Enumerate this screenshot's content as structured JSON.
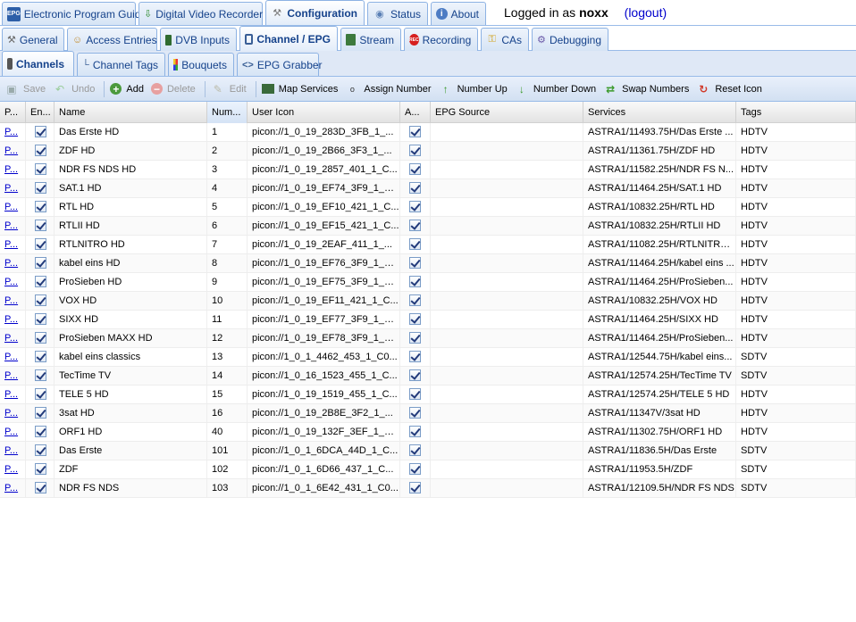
{
  "top_tabs": [
    {
      "label": "Electronic Program Guide",
      "icon": "epg-icon"
    },
    {
      "label": "Digital Video Recorder",
      "icon": "dvr-download-icon"
    },
    {
      "label": "Configuration",
      "icon": "wrench-icon"
    },
    {
      "label": "Status",
      "icon": "eye-icon"
    },
    {
      "label": "About",
      "icon": "info-icon"
    }
  ],
  "login": {
    "prefix": "Logged in as",
    "user": "noxx",
    "logout": "(logout)"
  },
  "config_tabs": [
    {
      "label": "General",
      "icon": "tools-icon"
    },
    {
      "label": "Access Entries",
      "icon": "users-icon"
    },
    {
      "label": "DVB Inputs",
      "icon": "card-icon"
    },
    {
      "label": "Channel / EPG",
      "icon": "tv-icon"
    },
    {
      "label": "Stream",
      "icon": "stream-icon"
    },
    {
      "label": "Recording",
      "icon": "rec-icon"
    },
    {
      "label": "CAs",
      "icon": "key-icon"
    },
    {
      "label": "Debugging",
      "icon": "bug-icon"
    }
  ],
  "channel_tabs": [
    {
      "label": "Channels",
      "icon": "remote-icon"
    },
    {
      "label": "Channel Tags",
      "icon": "tree-icon"
    },
    {
      "label": "Bouquets",
      "icon": "grid-icon"
    },
    {
      "label": "EPG Grabber",
      "icon": "code-icon"
    }
  ],
  "toolbar": {
    "save": "Save",
    "undo": "Undo",
    "add": "Add",
    "delete": "Delete",
    "edit": "Edit",
    "map_services": "Map Services",
    "assign_number": "Assign Number",
    "number_up": "Number Up",
    "number_down": "Number Down",
    "swap_numbers": "Swap Numbers",
    "reset_icon": "Reset Icon"
  },
  "columns": [
    "P...",
    "En...",
    "Name",
    "Num...",
    "User Icon",
    "A...",
    "EPG Source",
    "Services",
    "Tags"
  ],
  "rows": [
    {
      "p": "P...",
      "name": "Das Erste HD",
      "num": "1",
      "icon": "picon://1_0_19_283D_3FB_1_...",
      "epg": "",
      "services": "ASTRA1/11493.75H/Das Erste ...",
      "tags": "HDTV"
    },
    {
      "p": "P...",
      "name": "ZDF HD",
      "num": "2",
      "icon": "picon://1_0_19_2B66_3F3_1_...",
      "epg": "",
      "services": "ASTRA1/11361.75H/ZDF HD",
      "tags": "HDTV"
    },
    {
      "p": "P...",
      "name": "NDR FS NDS HD",
      "num": "3",
      "icon": "picon://1_0_19_2857_401_1_C...",
      "epg": "",
      "services": "ASTRA1/11582.25H/NDR FS N...",
      "tags": "HDTV"
    },
    {
      "p": "P...",
      "name": "SAT.1 HD",
      "num": "4",
      "icon": "picon://1_0_19_EF74_3F9_1_C...",
      "epg": "",
      "services": "ASTRA1/11464.25H/SAT.1 HD",
      "tags": "HDTV"
    },
    {
      "p": "P...",
      "name": "RTL HD",
      "num": "5",
      "icon": "picon://1_0_19_EF10_421_1_C...",
      "epg": "",
      "services": "ASTRA1/10832.25H/RTL HD",
      "tags": "HDTV"
    },
    {
      "p": "P...",
      "name": "RTLII HD",
      "num": "6",
      "icon": "picon://1_0_19_EF15_421_1_C...",
      "epg": "",
      "services": "ASTRA1/10832.25H/RTLII HD",
      "tags": "HDTV"
    },
    {
      "p": "P...",
      "name": "RTLNITRO HD",
      "num": "7",
      "icon": "picon://1_0_19_2EAF_411_1_...",
      "epg": "",
      "services": "ASTRA1/11082.25H/RTLNITRO...",
      "tags": "HDTV"
    },
    {
      "p": "P...",
      "name": "kabel eins HD",
      "num": "8",
      "icon": "picon://1_0_19_EF76_3F9_1_C...",
      "epg": "",
      "services": "ASTRA1/11464.25H/kabel eins ...",
      "tags": "HDTV"
    },
    {
      "p": "P...",
      "name": "ProSieben HD",
      "num": "9",
      "icon": "picon://1_0_19_EF75_3F9_1_C...",
      "epg": "",
      "services": "ASTRA1/11464.25H/ProSieben...",
      "tags": "HDTV"
    },
    {
      "p": "P...",
      "name": "VOX HD",
      "num": "10",
      "icon": "picon://1_0_19_EF11_421_1_C...",
      "epg": "",
      "services": "ASTRA1/10832.25H/VOX HD",
      "tags": "HDTV"
    },
    {
      "p": "P...",
      "name": "SIXX HD",
      "num": "11",
      "icon": "picon://1_0_19_EF77_3F9_1_C...",
      "epg": "",
      "services": "ASTRA1/11464.25H/SIXX HD",
      "tags": "HDTV"
    },
    {
      "p": "P...",
      "name": "ProSieben MAXX HD",
      "num": "12",
      "icon": "picon://1_0_19_EF78_3F9_1_C...",
      "epg": "",
      "services": "ASTRA1/11464.25H/ProSieben...",
      "tags": "HDTV"
    },
    {
      "p": "P...",
      "name": "kabel eins classics",
      "num": "13",
      "icon": "picon://1_0_1_4462_453_1_C0...",
      "epg": "",
      "services": "ASTRA1/12544.75H/kabel eins...",
      "tags": "SDTV"
    },
    {
      "p": "P...",
      "name": "TecTime TV",
      "num": "14",
      "icon": "picon://1_0_16_1523_455_1_C...",
      "epg": "",
      "services": "ASTRA1/12574.25H/TecTime TV",
      "tags": "SDTV"
    },
    {
      "p": "P...",
      "name": "TELE 5 HD",
      "num": "15",
      "icon": "picon://1_0_19_1519_455_1_C...",
      "epg": "",
      "services": "ASTRA1/12574.25H/TELE 5 HD",
      "tags": "HDTV"
    },
    {
      "p": "P...",
      "name": "3sat HD",
      "num": "16",
      "icon": "picon://1_0_19_2B8E_3F2_1_...",
      "epg": "",
      "services": "ASTRA1/11347V/3sat HD",
      "tags": "HDTV"
    },
    {
      "p": "P...",
      "name": "ORF1 HD",
      "num": "40",
      "icon": "picon://1_0_19_132F_3EF_1_C...",
      "epg": "",
      "services": "ASTRA1/11302.75H/ORF1 HD",
      "tags": "HDTV"
    },
    {
      "p": "P...",
      "name": "Das Erste",
      "num": "101",
      "icon": "picon://1_0_1_6DCA_44D_1_C...",
      "epg": "",
      "services": "ASTRA1/11836.5H/Das Erste",
      "tags": "SDTV"
    },
    {
      "p": "P...",
      "name": "ZDF",
      "num": "102",
      "icon": "picon://1_0_1_6D66_437_1_C...",
      "epg": "",
      "services": "ASTRA1/11953.5H/ZDF",
      "tags": "SDTV"
    },
    {
      "p": "P...",
      "name": "NDR FS NDS",
      "num": "103",
      "icon": "picon://1_0_1_6E42_431_1_C0...",
      "epg": "",
      "services": "ASTRA1/12109.5H/NDR FS NDS",
      "tags": "SDTV"
    }
  ]
}
